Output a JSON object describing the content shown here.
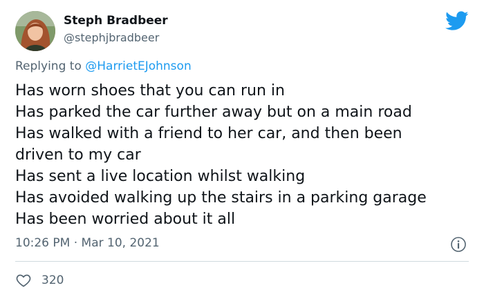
{
  "tweet": {
    "user": {
      "display_name": "Steph Bradbeer",
      "handle": "@stephjbradbeer",
      "avatar_icon": "profile-photo"
    },
    "brand_icon": "twitter-bird-icon",
    "brand_color": "#1d9bf0",
    "reply": {
      "prefix": "Replying to ",
      "mention": "@HarrietEJohnson"
    },
    "body_lines": [
      "Has worn shoes that you can run in",
      "Has parked the car further away but on a main road",
      "Has walked with a friend to her car, and then been",
      "driven to my car",
      "Has sent a live location whilst walking",
      "Has avoided walking up the stairs in a parking garage",
      "Has been worried about it all"
    ],
    "timestamp": {
      "time": "10:26 PM",
      "separator": " · ",
      "date": "Mar 10, 2021"
    },
    "info_icon": "info-icon",
    "likes": {
      "icon": "heart-icon",
      "count": "320"
    }
  }
}
